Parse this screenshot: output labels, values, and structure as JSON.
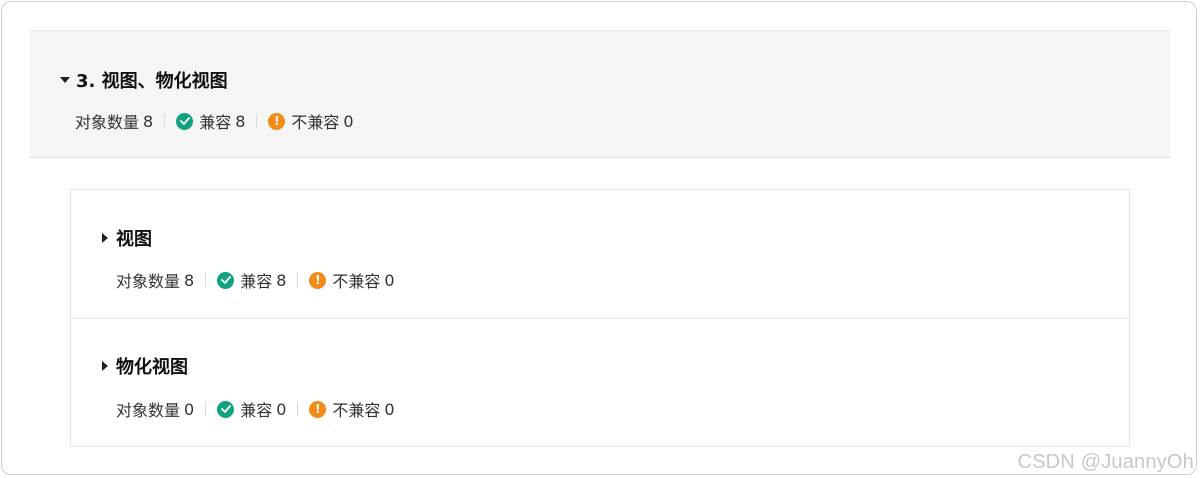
{
  "section": {
    "title": "3. 视图、物化视图",
    "stats": {
      "count_label": "对象数量",
      "count": "8",
      "ok_label": "兼容",
      "ok": "8",
      "warn_label": "不兼容",
      "warn": "0"
    }
  },
  "groups": [
    {
      "title": "视图",
      "stats": {
        "count_label": "对象数量",
        "count": "8",
        "ok_label": "兼容",
        "ok": "8",
        "warn_label": "不兼容",
        "warn": "0"
      }
    },
    {
      "title": "物化视图",
      "stats": {
        "count_label": "对象数量",
        "count": "0",
        "ok_label": "兼容",
        "ok": "0",
        "warn_label": "不兼容",
        "warn": "0"
      }
    }
  ],
  "icons": {
    "ok": "check-circle-icon",
    "warn": "exclamation-circle-icon"
  },
  "colors": {
    "ok": "#11a37f",
    "warn": "#f28b18"
  },
  "watermark": "CSDN @JuannyOh"
}
